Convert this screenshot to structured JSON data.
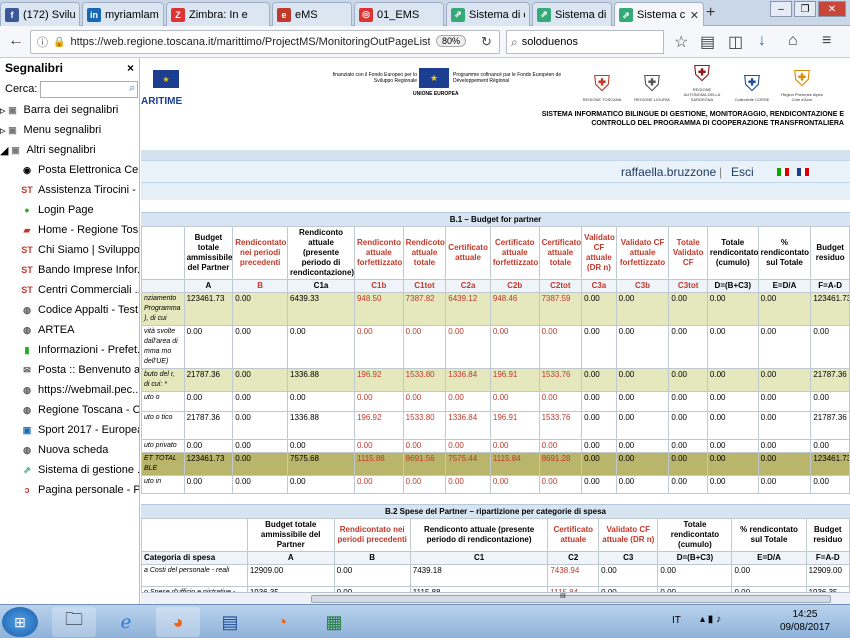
{
  "tabs": [
    {
      "label": "(172) Svilup",
      "color": "#3b5998",
      "glyph": "f"
    },
    {
      "label": "myriamlam",
      "color": "#1769b6",
      "glyph": "in"
    },
    {
      "label": "Zimbra: In e",
      "color": "#d33",
      "glyph": "Z"
    },
    {
      "label": "eMS",
      "color": "#c0392b",
      "glyph": "e"
    },
    {
      "label": "01_EMS",
      "color": "#d33",
      "glyph": "◎"
    },
    {
      "label": "Sistema di c",
      "color": "#3a7",
      "glyph": "⇗"
    },
    {
      "label": "Sistema di c",
      "color": "#3a7",
      "glyph": "⇗"
    },
    {
      "label": "Sistema c",
      "color": "#3a7",
      "glyph": "⇗"
    }
  ],
  "new_tab": "+",
  "nav": {
    "url": "https://web.regione.toscana.it/marittimo/ProjectMS/MonitoringOutPageList.jsf",
    "zoom": "80%",
    "search": "soloduenos"
  },
  "sidebar": {
    "title": "Segnalibri",
    "search_label": "Cerca:",
    "close": "×",
    "folders": [
      {
        "label": "Barra dei segnalibri"
      },
      {
        "label": "Menu segnalibri"
      },
      {
        "label": "Altri segnalibri"
      }
    ],
    "items": [
      {
        "label": "Posta Elettronica Cer...",
        "glyph": "◉",
        "color": "#000"
      },
      {
        "label": "Assistenza Tirocini - ...",
        "glyph": "ST",
        "color": "#c0392b"
      },
      {
        "label": "Login Page",
        "glyph": "●",
        "color": "#3a3"
      },
      {
        "label": "Home - Regione Tos...",
        "glyph": "▰",
        "color": "#c0392b"
      },
      {
        "label": "Chi Siamo | Sviluppo...",
        "glyph": "ST",
        "color": "#c0392b"
      },
      {
        "label": "Bando Imprese Infor...",
        "glyph": "ST",
        "color": "#c0392b"
      },
      {
        "label": "Centri Commerciali ...",
        "glyph": "ST",
        "color": "#c0392b"
      },
      {
        "label": "Codice Appalti - Test...",
        "glyph": "◍",
        "color": "#555"
      },
      {
        "label": "ARTEA",
        "glyph": "◍",
        "color": "#555"
      },
      {
        "label": "Informazioni - Prefet...",
        "glyph": "▮",
        "color": "#2a2"
      },
      {
        "label": "Posta :: Benvenuto a ...",
        "glyph": "✉",
        "color": "#555"
      },
      {
        "label": "https://webmail.pec....",
        "glyph": "◍",
        "color": "#555"
      },
      {
        "label": "Regione Toscana - C...",
        "glyph": "◍",
        "color": "#555"
      },
      {
        "label": "Sport 2017 - Europea...",
        "glyph": "▣",
        "color": "#1769b6"
      },
      {
        "label": "Nuova scheda",
        "glyph": "◍",
        "color": "#555"
      },
      {
        "label": "Sistema di gestione ...",
        "glyph": "⇗",
        "color": "#3a7"
      },
      {
        "label": "Pagina personale - P...",
        "glyph": "ↄ",
        "color": "#c0392b"
      }
    ]
  },
  "banner": {
    "left_brand": "ARITIME",
    "erdf_text": "finanziato con il Fondo Europeo per lo Sviluppo Regionale",
    "eu_text": "UNIONE EUROPEA",
    "fse_text": "Programme cofinancé par le Fonds Européen de Développement Régional",
    "logos": [
      "REGIONE TOSCANA",
      "REGIONE LIGURIA",
      "REGIONE AUTONOMA DELLA SARDEGNA",
      "Collectivité CORSE",
      "Région Provence Alpes Côte d'Azur"
    ],
    "system_title": "SISTEMA INFORMATICO BILINGUE DI GESTIONE, MONITORAGGIO, RENDICONTAZIONE E CONTROLLO DEL PROGRAMMA DI COOPERAZIONE TRANSFRONTALIERA",
    "user": "raffaella.bruzzone",
    "logout": "Esci"
  },
  "table1": {
    "title": "B.1 – Budget for partner",
    "headers": [
      "",
      "Budget totale ammissibile del Partner",
      "Rendicontato nei periodi precedenti",
      "Rendiconto attuale (presente periodo di rendicontazione)",
      "Rendiconto attuale forfettizzato",
      "Rendicoto attuale totale",
      "Certificato attuale",
      "Certificato attuale forfettizzato",
      "Certificato attuale totale",
      "Validato CF attuale (DR n)",
      "Validato CF attuale forfettizzato",
      "Totale Validato CF",
      "Totale rendicontato (cumulo)",
      "% rendicontato sul Totale",
      "Budget residuo"
    ],
    "letters": [
      "",
      "A",
      "B",
      "C1a",
      "C1b",
      "C1tot",
      "C2a",
      "C2b",
      "C2tot",
      "C3a",
      "C3b",
      "C3tot",
      "D=(B+C3)",
      "E=D/A",
      "F=A-D"
    ],
    "rows": [
      {
        "style": "hl",
        "label": "nziamento Programma ), di cui",
        "values": [
          "123461.73",
          "0.00",
          "6439.33",
          "948.50",
          "7387.82",
          "6439.12",
          "948.46",
          "7387.59",
          "0.00",
          "0.00",
          "0.00",
          "0.00",
          "0.00",
          "123461.73"
        ]
      },
      {
        "style": "",
        "label": "vità svolte dall'area di mma mo dell'UE)",
        "values": [
          "0.00",
          "0.00",
          "0.00",
          "0.00",
          "0.00",
          "0.00",
          "0.00",
          "0.00",
          "0.00",
          "0.00",
          "0.00",
          "0.00",
          "0.00",
          "0.00"
        ]
      },
      {
        "style": "hl",
        "label": "buto del r, di cui: *",
        "values": [
          "21787.36",
          "0.00",
          "1336.88",
          "196.92",
          "1533.80",
          "1336.84",
          "196.91",
          "1533.76",
          "0.00",
          "0.00",
          "0.00",
          "0.00",
          "0.00",
          "21787.36"
        ]
      },
      {
        "style": "",
        "label": "uto o",
        "values": [
          "0.00",
          "0.00",
          "0.00",
          "0.00",
          "0.00",
          "0.00",
          "0.00",
          "0.00",
          "0.00",
          "0.00",
          "0.00",
          "0.00",
          "0.00",
          "0.00"
        ]
      },
      {
        "style": "",
        "label": "uto o tico",
        "values": [
          "21787.36",
          "0.00",
          "1336.88",
          "196.92",
          "1533.80",
          "1336.84",
          "196.91",
          "1533.76",
          "0.00",
          "0.00",
          "0.00",
          "0.00",
          "0.00",
          "21787.36"
        ]
      },
      {
        "style": "",
        "label": "uto privato",
        "values": [
          "0.00",
          "0.00",
          "0.00",
          "0.00",
          "0.00",
          "0.00",
          "0.00",
          "0.00",
          "0.00",
          "0.00",
          "0.00",
          "0.00",
          "0.00",
          "0.00"
        ]
      },
      {
        "style": "dark",
        "label": "ET TOTAL BLE",
        "values": [
          "123461.73",
          "0.00",
          "7575.68",
          "1115.88",
          "8691.56",
          "7575.44",
          "1115.84",
          "8691.28",
          "0.00",
          "0.00",
          "0.00",
          "0.00",
          "0.00",
          "123461.73"
        ]
      },
      {
        "style": "",
        "label": "uto in",
        "values": [
          "0.00",
          "0.00",
          "0.00",
          "0.00",
          "0.00",
          "0.00",
          "0.00",
          "0.00",
          "0.00",
          "0.00",
          "0.00",
          "0.00",
          "0.00",
          "0.00"
        ]
      }
    ]
  },
  "table2": {
    "title": "B.2 Spese del Partner – ripartizione per categorie di spesa",
    "headers": [
      "",
      "Budget totale ammissibile del Partner",
      "Rendicontato nei periodi precedenti",
      "Rendiconto attuale (presente periodo di rendicontazione)",
      "Certificato attuale",
      "Validato CF attuale (DR n)",
      "Totale rendicontato (cumulo)",
      "% rendicontato sul Totale",
      "Budget residuo"
    ],
    "letters": [
      "Categoria di spesa",
      "A",
      "B",
      "C1",
      "C2",
      "C3",
      "D=(B+C3)",
      "E=D/A",
      "F=A-D"
    ],
    "rows": [
      {
        "label": "a Costi del personale - reali",
        "values": [
          "12909.00",
          "0.00",
          "7439.18",
          "7438.94",
          "0.00",
          "0.00",
          "0.00",
          "12909.00"
        ]
      },
      {
        "label": "o Spese d'ufficio e nistrative - tasso ario",
        "values": [
          "1936.35",
          "0.00",
          "1115.88",
          "1115.84",
          "0.00",
          "0.00",
          "0.00",
          "1936.35"
        ]
      }
    ]
  },
  "scroll": {
    "grip": "III"
  },
  "taskbar": {
    "time": "14:25",
    "date": "09/08/2017",
    "lang": "IT"
  }
}
